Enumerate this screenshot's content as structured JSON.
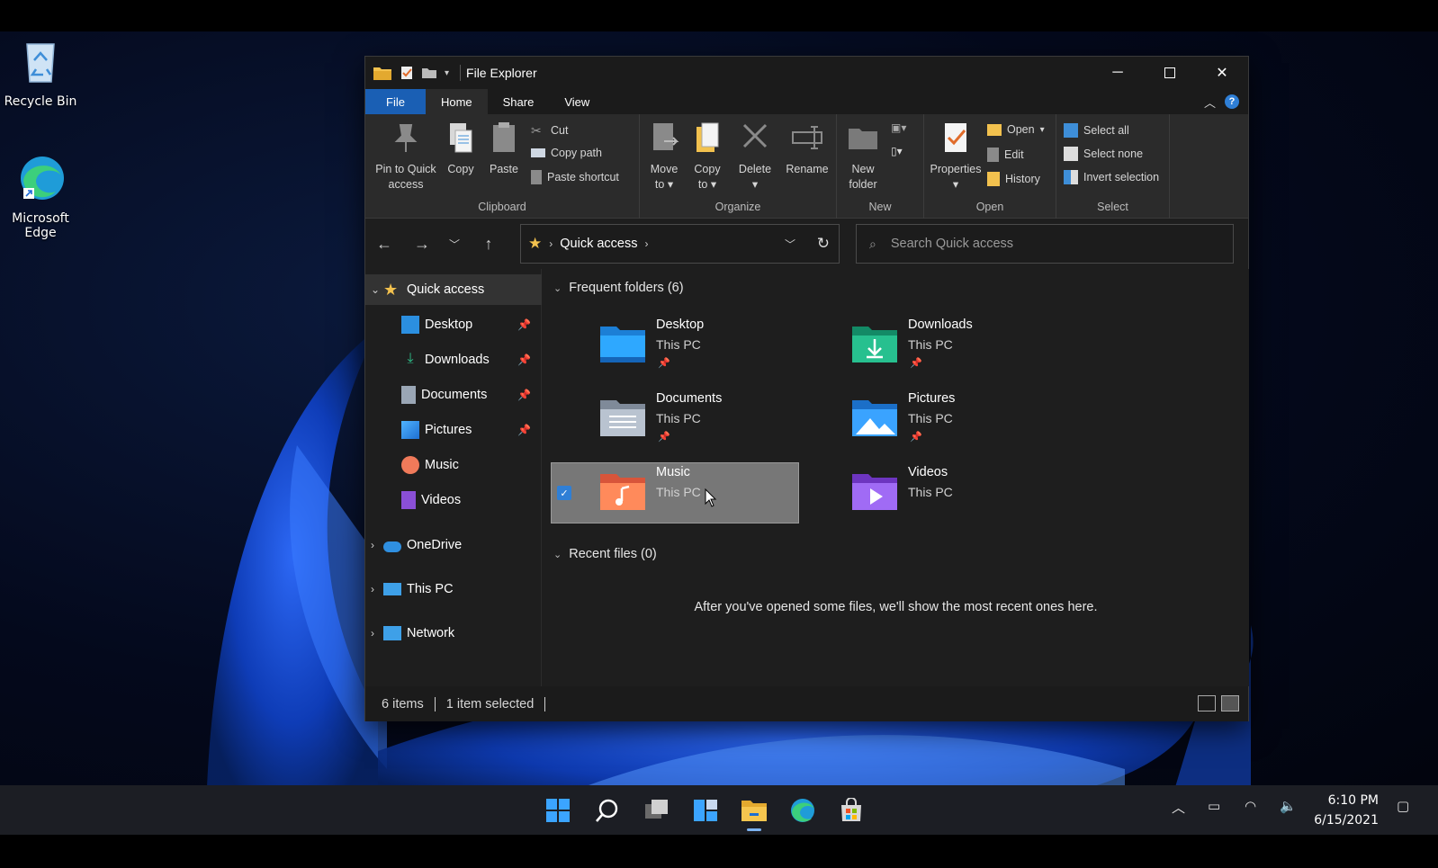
{
  "desktop": {
    "icons": [
      {
        "label": "Recycle Bin"
      },
      {
        "label": "Microsoft\nEdge",
        "line1": "Microsoft",
        "line2": "Edge"
      }
    ]
  },
  "window": {
    "title": "File Explorer",
    "tabs": [
      "File",
      "Home",
      "Share",
      "View"
    ],
    "active_tab": "Home",
    "help_label": "?"
  },
  "ribbon": {
    "clipboard": {
      "label": "Clipboard",
      "pin": [
        "Pin to Quick",
        "access"
      ],
      "copy": "Copy",
      "paste": "Paste",
      "cut": "Cut",
      "copy_path": "Copy path",
      "paste_shortcut": "Paste shortcut"
    },
    "organize": {
      "label": "Organize",
      "move_to": [
        "Move",
        "to"
      ],
      "copy_to": [
        "Copy",
        "to"
      ],
      "delete": "Delete",
      "rename": "Rename"
    },
    "new": {
      "label": "New",
      "new_folder": [
        "New",
        "folder"
      ]
    },
    "open": {
      "label": "Open",
      "properties": "Properties",
      "open": "Open",
      "edit": "Edit",
      "history": "History"
    },
    "select": {
      "label": "Select",
      "select_all": "Select all",
      "select_none": "Select none",
      "invert": "Invert selection"
    }
  },
  "address": {
    "location": "Quick access",
    "search_placeholder": "Search Quick access"
  },
  "nav_pane": {
    "quick_access": "Quick access",
    "items": [
      {
        "label": "Desktop",
        "pinned": true
      },
      {
        "label": "Downloads",
        "pinned": true
      },
      {
        "label": "Documents",
        "pinned": true
      },
      {
        "label": "Pictures",
        "pinned": true
      },
      {
        "label": "Music",
        "pinned": false
      },
      {
        "label": "Videos",
        "pinned": false
      }
    ],
    "roots": [
      {
        "label": "OneDrive"
      },
      {
        "label": "This PC"
      },
      {
        "label": "Network"
      }
    ]
  },
  "content": {
    "frequent_header": "Frequent folders (6)",
    "folders": [
      {
        "name": "Desktop",
        "location": "This PC",
        "pinned": true
      },
      {
        "name": "Downloads",
        "location": "This PC",
        "pinned": true
      },
      {
        "name": "Documents",
        "location": "This PC",
        "pinned": true
      },
      {
        "name": "Pictures",
        "location": "This PC",
        "pinned": true
      },
      {
        "name": "Music",
        "location": "This PC",
        "pinned": false,
        "selected": true
      },
      {
        "name": "Videos",
        "location": "This PC",
        "pinned": false
      }
    ],
    "recent_header": "Recent files (0)",
    "recent_empty": "After you've opened some files, we'll show the most recent ones here."
  },
  "status": {
    "item_count": "6 items",
    "selection": "1 item selected"
  },
  "taskbar": {
    "time": "6:10 PM",
    "date": "6/15/2021"
  },
  "colors": {
    "accent": "#1a5fb4",
    "folder_yellow": "#f2c14e",
    "selection": "#777777"
  }
}
